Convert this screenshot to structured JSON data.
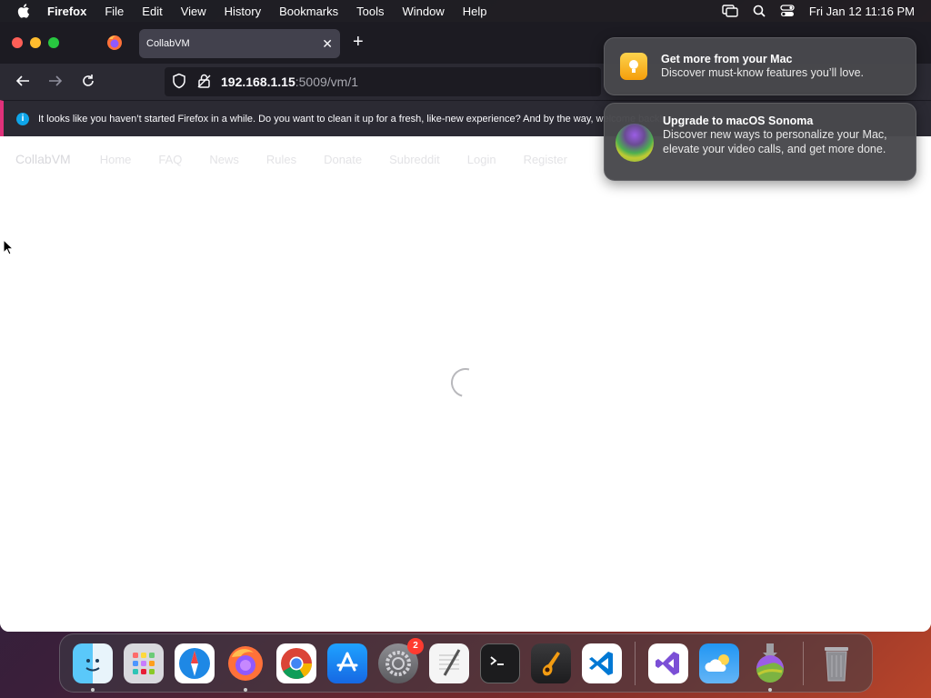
{
  "menubar": {
    "app_name": "Firefox",
    "items": [
      "File",
      "Edit",
      "View",
      "History",
      "Bookmarks",
      "Tools",
      "Window",
      "Help"
    ],
    "clock": "Fri Jan 12  11:16 PM"
  },
  "browser": {
    "tab_title": "CollabVM",
    "url_host": "192.168.1.15",
    "url_path": ":5009/vm/1",
    "infobar_text": "It looks like you haven’t started Firefox in a while. Do you want to clean it up for a fresh, like-new experience? And by the way, welcome back!"
  },
  "site": {
    "brand": "CollabVM",
    "nav": [
      "Home",
      "FAQ",
      "News",
      "Rules",
      "Donate",
      "Subreddit",
      "Login",
      "Register"
    ]
  },
  "notifications": [
    {
      "title": "Get more from your Mac",
      "body": "Discover must-know features you’ll love."
    },
    {
      "title": "Upgrade to macOS Sonoma",
      "body": "Discover new ways to personalize your Mac, elevate your video calls, and get more done."
    }
  ],
  "dock": {
    "settings_badge": "2"
  },
  "colors": {
    "accent_pink": "#e0317a",
    "info_blue": "#0ea5e9",
    "tab_bg": "#42414d"
  }
}
